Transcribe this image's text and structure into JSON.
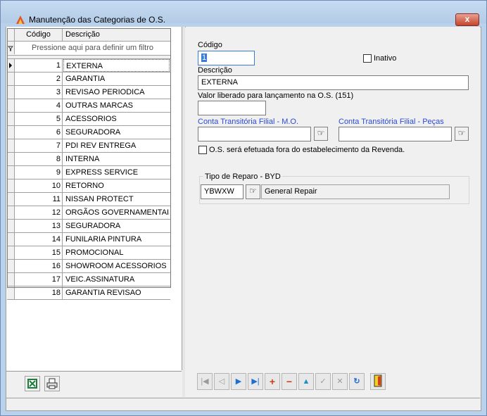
{
  "window": {
    "title": "Manutenção das Categorias de O.S.",
    "close_label": "x"
  },
  "grid": {
    "headers": {
      "code": "Código",
      "desc": "Descrição"
    },
    "filter_text": "Pressione aqui para definir um filtro",
    "rows": [
      {
        "code": "1",
        "desc": "EXTERNA"
      },
      {
        "code": "2",
        "desc": "GARANTIA"
      },
      {
        "code": "3",
        "desc": "REVISAO PERIODICA"
      },
      {
        "code": "4",
        "desc": "OUTRAS MARCAS"
      },
      {
        "code": "5",
        "desc": "ACESSORIOS"
      },
      {
        "code": "6",
        "desc": "SEGURADORA"
      },
      {
        "code": "7",
        "desc": "PDI REV ENTREGA"
      },
      {
        "code": "8",
        "desc": "INTERNA"
      },
      {
        "code": "9",
        "desc": "EXPRESS SERVICE"
      },
      {
        "code": "10",
        "desc": "RETORNO"
      },
      {
        "code": "11",
        "desc": "NISSAN PROTECT"
      },
      {
        "code": "12",
        "desc": "ORGÃOS GOVERNAMENTAIS"
      },
      {
        "code": "13",
        "desc": "SEGURADORA"
      },
      {
        "code": "14",
        "desc": "FUNILARIA PINTURA"
      },
      {
        "code": "15",
        "desc": "PROMOCIONAL"
      },
      {
        "code": "16",
        "desc": "SHOWROOM ACESSORIOS"
      },
      {
        "code": "17",
        "desc": "VEIC.ASSINATURA"
      },
      {
        "code": "18",
        "desc": "GARANTIA REVISAO"
      }
    ]
  },
  "form": {
    "codigo_label": "Código",
    "codigo_value": "1",
    "inativo_label": "Inativo",
    "descricao_label": "Descrição",
    "descricao_value": "EXTERNA",
    "valor_label": "Valor liberado para lançamento na O.S. (151)",
    "valor_value": "",
    "conta_mo_label": "Conta Transitória Filial - M.O.",
    "conta_mo_value": "",
    "conta_pecas_label": "Conta Transitória Filial - Peças",
    "conta_pecas_value": "",
    "fora_label": "O.S. será efetuada fora do estabelecimento da Revenda.",
    "tipo_reparo_title": "Tipo de Reparo - BYD",
    "tipo_reparo_code": "YBWXW",
    "tipo_reparo_desc": "General Repair"
  },
  "nav_buttons": [
    "first",
    "prior",
    "next",
    "last",
    "insert",
    "delete",
    "edit",
    "post",
    "cancel",
    "refresh"
  ],
  "colors": {
    "link_blue": "#2a4bd4",
    "title_bg": "#b9d1ea"
  }
}
